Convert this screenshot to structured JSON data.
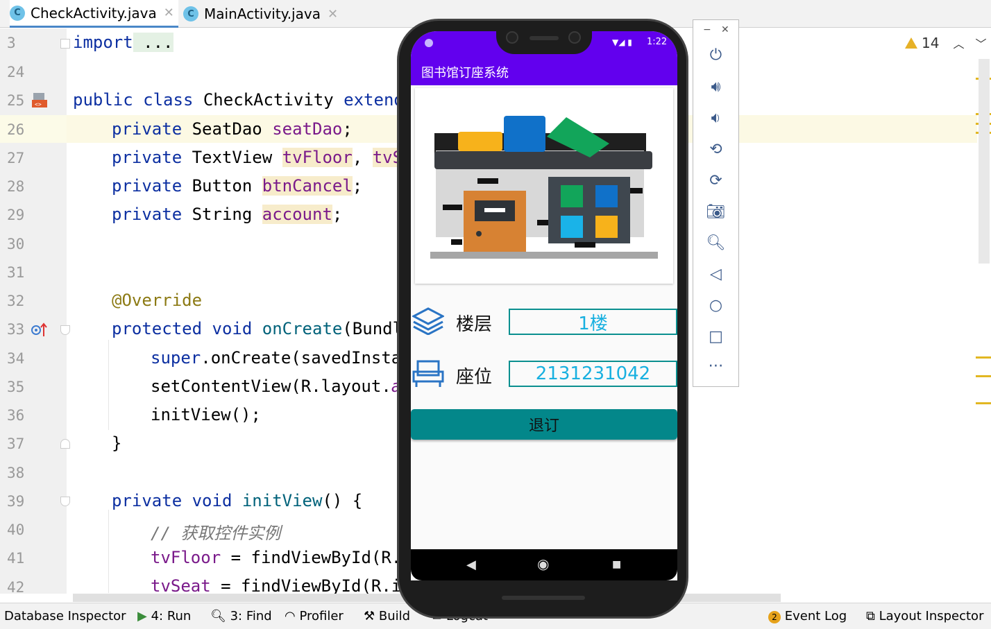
{
  "tabs": [
    {
      "icon": "C",
      "label": "CheckActivity.java",
      "active": true
    },
    {
      "icon": "C",
      "label": "MainActivity.java",
      "active": false
    }
  ],
  "line_numbers": [
    "3",
    "24",
    "25",
    "26",
    "27",
    "28",
    "29",
    "30",
    "31",
    "32",
    "33",
    "34",
    "35",
    "36",
    "37",
    "38",
    "39",
    "40",
    "41",
    "42"
  ],
  "code": {
    "l3": {
      "kw": "import",
      "rest": " ..."
    },
    "l25": {
      "kw1": "public class",
      "name": " CheckActivity ",
      "kw2": "extends"
    },
    "l26": {
      "kw": "private",
      "type": " SeatDao ",
      "field": "seatDao",
      "end": ";"
    },
    "l27": {
      "kw": "private",
      "type": " TextView ",
      "field": "tvFloor",
      "sep": ", ",
      "field2": "tvSe"
    },
    "l28": {
      "kw": "private",
      "type": " Button ",
      "field": "btnCancel",
      "end": ";"
    },
    "l29": {
      "kw": "private",
      "type": " String ",
      "field": "account",
      "end": ";"
    },
    "l32": {
      "ann": "@Override"
    },
    "l33": {
      "kw": "protected void",
      "mth": " onCreate",
      "rest": "(Bundle"
    },
    "l34": {
      "kw": "super",
      "rest": ".onCreate(savedInstan"
    },
    "l35": {
      "rest": "setContentView(R.layout.",
      "fld": "ac"
    },
    "l36": {
      "rest": "initView();"
    },
    "l37": {
      "rest": "}"
    },
    "l39": {
      "kw": "private void",
      "mth": " initView",
      "rest": "() {"
    },
    "l40": {
      "cmt": "// 获取控件实例"
    },
    "l41": {
      "fld": "tvFloor",
      "rest": " = findViewById(R.i"
    },
    "l42": {
      "fld": "tvSeat",
      "rest": " = findViewById(R.id"
    }
  },
  "warnings": {
    "count": "14",
    "up_icon": "chevron-up-icon",
    "down_icon": "chevron-down-icon"
  },
  "bottom_bar": {
    "database_inspector": "Database Inspector",
    "run": "4: Run",
    "find": "3: Find",
    "profiler": "Profiler",
    "build": "Build",
    "logcat": "Logcat",
    "event_log_badge": "2",
    "event_log": "Event Log",
    "layout_inspector": "Layout Inspector"
  },
  "phone": {
    "time": "1:22",
    "app_title": "图书馆订座系统",
    "floor_label": "楼层",
    "floor_value": "1楼",
    "seat_label": "座位",
    "seat_value": "2131231042",
    "cancel_button": "退订"
  },
  "emulator_toolbar": [
    "power-icon",
    "volume-up-icon",
    "volume-down-icon",
    "rotate-left-icon",
    "rotate-right-icon",
    "camera-icon",
    "zoom-icon",
    "back-icon",
    "home-icon",
    "overview-icon",
    "more-icon"
  ],
  "colors": {
    "status_bar": "#6200ee",
    "button": "#03878a",
    "field_text": "#18b0e0",
    "keyword": "#0c2fa1",
    "field": "#7a1a8a"
  }
}
